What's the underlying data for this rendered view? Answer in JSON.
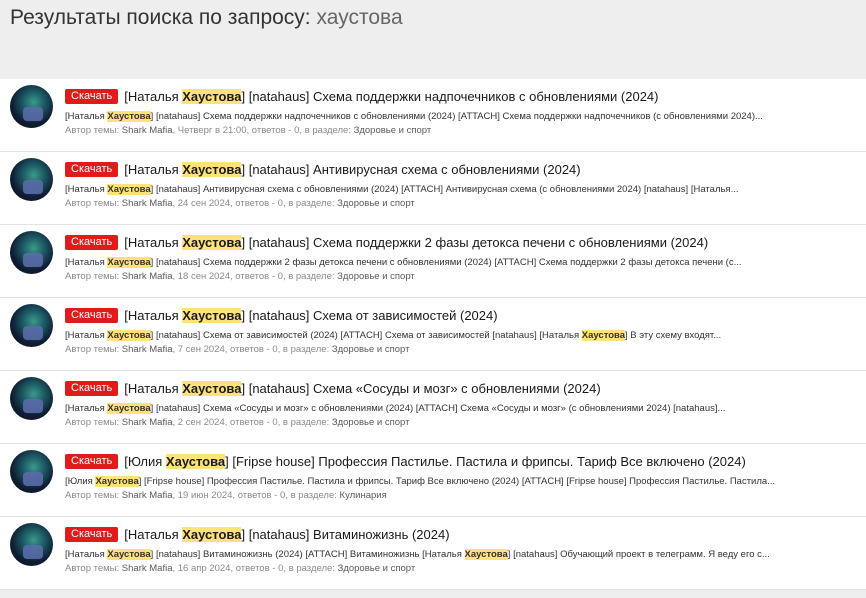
{
  "header": {
    "title_prefix": "Результаты поиска по запросу:",
    "query": "хаустова"
  },
  "labels": {
    "download": "Скачать",
    "author_prefix": "Автор темы:",
    "section_prefix": ", в разделе:"
  },
  "colors": {
    "download_button": "#e01b1b",
    "highlight": "#ffe27a"
  },
  "results": [
    {
      "title_pre": "[Наталья ",
      "title_hl": "Хаустова",
      "title_post": "] [natahaus] Схема поддержки надпочечников с обновлениями (2024)",
      "snippet_html": "[Наталья <mark>Хаустова</mark>] [natahaus] Схема поддержки надпочечников с обновлениями (2024) [ATTACH] Схема поддержки надпочечников (с обновлениями 2024)...",
      "author": "Shark Mafia",
      "stats": ", Четверг в 21:00, ответов - 0",
      "section": "Здоровье и спорт"
    },
    {
      "title_pre": "[Наталья ",
      "title_hl": "Хаустова",
      "title_post": "] [natahaus] Антивирусная схема с обновлениями (2024)",
      "snippet_html": "[Наталья <mark>Хаустова</mark>] [natahaus] Антивирусная схема с обновлениями (2024) [ATTACH] Антивирусная схема (с обновлениями 2024) [natahaus] [Наталья...",
      "author": "Shark Mafia",
      "stats": ", 24 сен 2024, ответов - 0",
      "section": "Здоровье и спорт"
    },
    {
      "title_pre": "[Наталья ",
      "title_hl": "Хаустова",
      "title_post": "] [natahaus] Схема поддержки 2 фазы детокса печени с обновлениями (2024)",
      "snippet_html": "[Наталья <mark>Хаустова</mark>] [natahaus] Схема поддержки 2 фазы детокса печени с обновлениями (2024) [ATTACH] Схема поддержки 2 фазы детокса печени (с...",
      "author": "Shark Mafia",
      "stats": ", 18 сен 2024, ответов - 0",
      "section": "Здоровье и спорт"
    },
    {
      "title_pre": "[Наталья ",
      "title_hl": "Хаустова",
      "title_post": "] [natahaus] Схема от зависимостей (2024)",
      "snippet_html": "[Наталья <mark>Хаустова</mark>] [natahaus] Схема от зависимостей (2024) [ATTACH] Схема от зависимостей [natahaus] [Наталья <mark>Хаустова</mark>] В эту схему входят...",
      "author": "Shark Mafia",
      "stats": ", 7 сен 2024, ответов - 0",
      "section": "Здоровье и спорт"
    },
    {
      "title_pre": "[Наталья ",
      "title_hl": "Хаустова",
      "title_post": "] [natahaus] Схема «Сосуды и мозг» с обновлениями (2024)",
      "snippet_html": "[Наталья <mark>Хаустова</mark>] [natahaus] Схема «Сосуды и мозг» с обновлениями (2024) [ATTACH] Схема «Сосуды и мозг» (с обновлениями 2024) [natahaus]...",
      "author": "Shark Mafia",
      "stats": ", 2 сен 2024, ответов - 0",
      "section": "Здоровье и спорт"
    },
    {
      "title_pre": "[Юлия ",
      "title_hl": "Хаустова",
      "title_post": "] [Fripse house] Профессия Пастилье. Пастила и фрипсы. Тариф Все включено (2024)",
      "snippet_html": "[Юлия <mark>Хаустова</mark>] [Fripse house] Профессия Пастилье. Пастила и фрипсы. Тариф Все включено (2024) [ATTACH] [Fripse house] Профессия Пастилье. Пастила...",
      "author": "Shark Mafia",
      "stats": ", 19 июн 2024, ответов - 0",
      "section": "Кулинария"
    },
    {
      "title_pre": "[Наталья ",
      "title_hl": "Хаустова",
      "title_post": "] [natahaus] Витаминожизнь (2024)",
      "snippet_html": "[Наталья <mark>Хаустова</mark>] [natahaus] Витаминожизнь (2024) [ATTACH] Витаминожизнь [Наталья <mark>Хаустова</mark>] [natahaus] Обучающий проект в телеграмм. Я веду его с...",
      "author": "Shark Mafia",
      "stats": ", 16 апр 2024, ответов - 0",
      "section": "Здоровье и спорт"
    }
  ]
}
